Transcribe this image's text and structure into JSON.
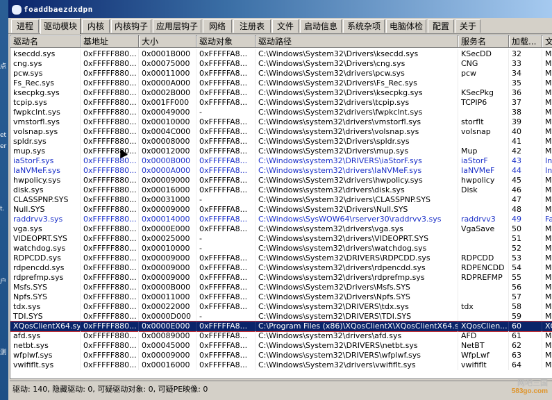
{
  "window": {
    "title": "foaddbaezdxdpn"
  },
  "desktop_strip": [
    "点",
    "et",
    "er",
    "t.",
    "户",
    "测"
  ],
  "tabs": [
    "进程",
    "驱动模块",
    "内核",
    "内核钩子",
    "应用层钩子",
    "网络",
    "注册表",
    "文件",
    "启动信息",
    "系统杂项",
    "电脑体检",
    "配置",
    "关于"
  ],
  "active_tab": 1,
  "columns": [
    "驱动名",
    "基地址",
    "大小",
    "驱动对象",
    "驱动路径",
    "服务名",
    "加载...",
    "文"
  ],
  "rows": [
    [
      "ksecdd.sys",
      "0xFFFFF880...",
      "0x0001B000",
      "0xFFFFFA8...",
      "C:\\Windows\\System32\\Drivers\\ksecdd.sys",
      "KSecDD",
      "32",
      "Mi"
    ],
    [
      "cng.sys",
      "0xFFFFF880...",
      "0x00075000",
      "0xFFFFFA8...",
      "C:\\Windows\\System32\\Drivers\\cng.sys",
      "CNG",
      "33",
      "Mi"
    ],
    [
      "pcw.sys",
      "0xFFFFF880...",
      "0x00011000",
      "0xFFFFFA8...",
      "C:\\Windows\\System32\\drivers\\pcw.sys",
      "pcw",
      "34",
      "Mi"
    ],
    [
      "Fs_Rec.sys",
      "0xFFFFF880...",
      "0x0000A000",
      "0xFFFFFA8...",
      "C:\\Windows\\System32\\Drivers\\Fs_Rec.sys",
      "",
      "35",
      "Mi"
    ],
    [
      "ksecpkg.sys",
      "0xFFFFF880...",
      "0x0002B000",
      "0xFFFFFA8...",
      "C:\\Windows\\System32\\Drivers\\ksecpkg.sys",
      "KSecPkg",
      "36",
      "Mi"
    ],
    [
      "tcpip.sys",
      "0xFFFFF880...",
      "0x001FF000",
      "0xFFFFFA8...",
      "C:\\Windows\\System32\\drivers\\tcpip.sys",
      "TCPIP6",
      "37",
      "Mi"
    ],
    [
      "fwpkclnt.sys",
      "0xFFFFF880...",
      "0x00049000",
      "-",
      "C:\\Windows\\System32\\drivers\\fwpkclnt.sys",
      "",
      "38",
      "Mi"
    ],
    [
      "vmstorfl.sys",
      "0xFFFFF880...",
      "0x00010000",
      "0xFFFFFA8...",
      "C:\\Windows\\system32\\drivers\\vmstorfl.sys",
      "storflt",
      "39",
      "Mi"
    ],
    [
      "volsnap.sys",
      "0xFFFFF880...",
      "0x0004C000",
      "0xFFFFFA8...",
      "C:\\Windows\\system32\\drivers\\volsnap.sys",
      "volsnap",
      "40",
      "Mi"
    ],
    [
      "spldr.sys",
      "0xFFFFF880...",
      "0x00008000",
      "0xFFFFFA8...",
      "C:\\Windows\\System32\\Drivers\\spldr.sys",
      "",
      "41",
      "Mi"
    ],
    [
      "mup.sys",
      "0xFFFFF880...",
      "0x00012000",
      "0xFFFFFA8...",
      "C:\\Windows\\System32\\Drivers\\mup.sys",
      "Mup",
      "42",
      "Mi"
    ],
    [
      "iaStorF.sys",
      "0xFFFFF880...",
      "0x0000B000",
      "0xFFFFFA8...",
      "C:\\Windows\\system32\\DRIVERS\\iaStorF.sys",
      "iaStorF",
      "43",
      "Int"
    ],
    [
      "IaNVMeF.sys",
      "0xFFFFF880...",
      "0x0000A000",
      "0xFFFFFA8...",
      "C:\\Windows\\system32\\drivers\\IaNVMeF.sys",
      "IaNVMeF",
      "44",
      "Int"
    ],
    [
      "hwpolicy.sys",
      "0xFFFFF880...",
      "0x00009000",
      "0xFFFFFA8...",
      "C:\\Windows\\System32\\drivers\\hwpolicy.sys",
      "hwpolicy",
      "45",
      "Mi"
    ],
    [
      "disk.sys",
      "0xFFFFF880...",
      "0x00016000",
      "0xFFFFFA8...",
      "C:\\Windows\\system32\\drivers\\disk.sys",
      "Disk",
      "46",
      "Mi"
    ],
    [
      "CLASSPNP.SYS",
      "0xFFFFF880...",
      "0x00031000",
      "-",
      "C:\\Windows\\System32\\drivers\\CLASSPNP.SYS",
      "",
      "47",
      "Mi"
    ],
    [
      "Null.SYS",
      "0xFFFFF880...",
      "0x00009000",
      "0xFFFFFA8...",
      "C:\\Windows\\System32\\Drivers\\Null.SYS",
      "",
      "48",
      "Mi"
    ],
    [
      "raddrvv3.sys",
      "0xFFFFF880...",
      "0x00014000",
      "0xFFFFFA8...",
      "C:\\Windows\\SysWOW64\\rserver30\\raddrvv3.sys",
      "raddrvv3",
      "49",
      "Fa"
    ],
    [
      "vga.sys",
      "0xFFFFF880...",
      "0x0000E000",
      "0xFFFFFA8...",
      "C:\\Windows\\system32\\drivers\\vga.sys",
      "VgaSave",
      "50",
      "Mi"
    ],
    [
      "VIDEOPRT.SYS",
      "0xFFFFF880...",
      "0x00025000",
      "-",
      "C:\\Windows\\system32\\drivers\\VIDEOPRT.SYS",
      "",
      "51",
      "Mi"
    ],
    [
      "watchdog.sys",
      "0xFFFFF880...",
      "0x00010000",
      "-",
      "C:\\Windows\\system32\\drivers\\watchdog.sys",
      "",
      "52",
      "Mi"
    ],
    [
      "RDPCDD.sys",
      "0xFFFFF880...",
      "0x00009000",
      "0xFFFFFA8...",
      "C:\\Windows\\System32\\DRIVERS\\RDPCDD.sys",
      "RDPCDD",
      "53",
      "Mi"
    ],
    [
      "rdpencdd.sys",
      "0xFFFFF880...",
      "0x00009000",
      "0xFFFFFA8...",
      "C:\\Windows\\system32\\drivers\\rdpencdd.sys",
      "RDPENCDD",
      "54",
      "Mi"
    ],
    [
      "rdprefmp.sys",
      "0xFFFFF880...",
      "0x00009000",
      "0xFFFFFA8...",
      "C:\\Windows\\system32\\drivers\\rdprefmp.sys",
      "RDPREFMP",
      "55",
      "Mi"
    ],
    [
      "Msfs.SYS",
      "0xFFFFF880...",
      "0x0000B000",
      "0xFFFFFA8...",
      "C:\\Windows\\System32\\Drivers\\Msfs.SYS",
      "",
      "56",
      "Mi"
    ],
    [
      "Npfs.SYS",
      "0xFFFFF880...",
      "0x00011000",
      "0xFFFFFA8...",
      "C:\\Windows\\System32\\Drivers\\Npfs.SYS",
      "",
      "57",
      "Mi"
    ],
    [
      "tdx.sys",
      "0xFFFFF880...",
      "0x00022000",
      "0xFFFFFA8...",
      "C:\\Windows\\system32\\DRIVERS\\tdx.sys",
      "tdx",
      "58",
      "Mi"
    ],
    [
      "TDI.SYS",
      "0xFFFFF880...",
      "0x0000D000",
      "-",
      "C:\\Windows\\system32\\DRIVERS\\TDI.SYS",
      "",
      "59",
      "Mi"
    ],
    [
      "XQosClientX64.sys",
      "0xFFFFF880...",
      "0x0000E000",
      "0xFFFFFA8...",
      "C:\\Program Files (x86)\\XQosClientX\\XQosClientX64.sys",
      "XQosClien...",
      "60",
      "XQ"
    ],
    [
      "afd.sys",
      "0xFFFFF880...",
      "0x00089000",
      "0xFFFFFA8...",
      "C:\\Windows\\system32\\drivers\\afd.sys",
      "AFD",
      "61",
      "Mi"
    ],
    [
      "netbt.sys",
      "0xFFFFF880...",
      "0x00045000",
      "0xFFFFFA8...",
      "C:\\Windows\\System32\\DRIVERS\\netbt.sys",
      "NetBT",
      "62",
      "Mi"
    ],
    [
      "wfplwf.sys",
      "0xFFFFF880...",
      "0x00009000",
      "0xFFFFFA8...",
      "C:\\Windows\\system32\\DRIVERS\\wfplwf.sys",
      "WfpLwf",
      "63",
      "Mi"
    ],
    [
      "vwififlt.sys",
      "0xFFFFF880...",
      "0x00016000",
      "0xFFFFFA8...",
      "C:\\Windows\\System32\\drivers\\vwififlt.sys",
      "vwififlt",
      "64",
      "Mi"
    ]
  ],
  "blue_rows": [
    11,
    12,
    17
  ],
  "selected_row": 28,
  "status": "驱动: 140, 隐藏驱动: 0, 可疑驱动对象: 0, 可疑PE映像: 0",
  "watermark": {
    "line1": "网吧三国",
    "line2": "583go.com"
  },
  "colors": {
    "titlebar": "#0a246a",
    "selection": "#0a246a",
    "selection_outline": "#d03030",
    "blue_text": "#1a2fc8"
  }
}
